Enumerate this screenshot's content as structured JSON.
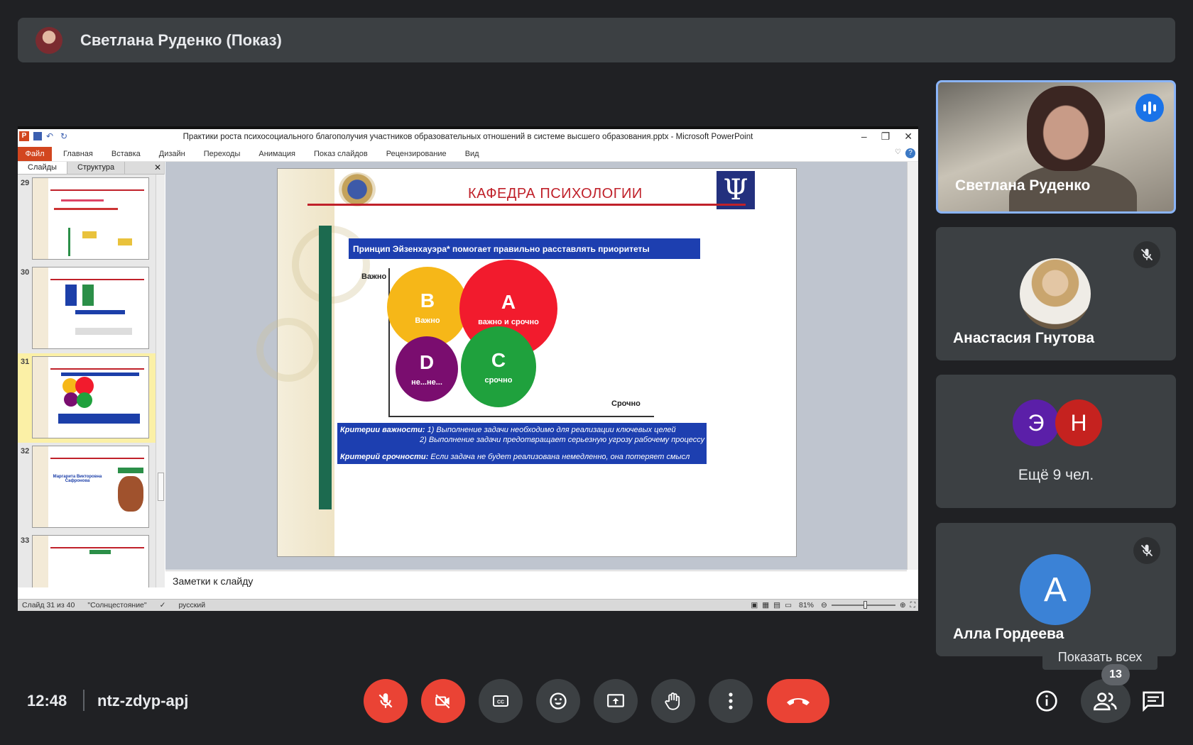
{
  "meet": {
    "presenter_title": "Светлана Руденко (Показ)",
    "clock": "12:48",
    "meeting_code": "ntz-zdyp-apj",
    "show_all_tooltip": "Показать всех",
    "participants_count": "13",
    "tiles": [
      {
        "name": "Светлана Руденко",
        "speaking": true
      },
      {
        "name": "Анастасия Гнутова",
        "muted": true
      },
      {
        "avatars": [
          {
            "letter": "Э",
            "color": "#5b1fa8"
          },
          {
            "letter": "Н",
            "color": "#c5221f"
          }
        ],
        "more": "Ещё 9 чел."
      },
      {
        "name": "Алла Гордеева",
        "letter": "А",
        "muted": true
      }
    ],
    "accent_red": "#ea4335",
    "accent_blue": "#1a73e8"
  },
  "ppt": {
    "window_title": "Практики роста психосоциального благополучия участников образовательных отношений в системе высшего образования.pptx  -  Microsoft PowerPoint",
    "ribbon_file": "Файл",
    "ribbon_tabs": [
      "Главная",
      "Вставка",
      "Дизайн",
      "Переходы",
      "Анимация",
      "Показ слайдов",
      "Рецензирование",
      "Вид"
    ],
    "panel_tabs": [
      "Слайды",
      "Структура"
    ],
    "thumb_numbers": [
      "29",
      "30",
      "31",
      "32",
      "33"
    ],
    "thumb32_name": "Маргарита Викторовна Сафронова",
    "notes_placeholder": "Заметки к слайду",
    "status": {
      "slide": "Слайд 31 из 40",
      "theme": "\"Солнцестояние\"",
      "lang": "русский",
      "zoom": "81%"
    },
    "slide": {
      "header": "КАФЕДРА ПСИХОЛОГИИ",
      "banner": "Принцип Эйзенхауэра* помогает правильно расставлять приоритеты",
      "axis_v": "Важно",
      "axis_h": "Срочно",
      "circles": [
        {
          "letter": "B",
          "label": "Важно",
          "color": "#f6b718"
        },
        {
          "letter": "A",
          "label": "важно и срочно",
          "color": "#f21b2d"
        },
        {
          "letter": "D",
          "label": "не...не...",
          "color": "#7a0d6f"
        },
        {
          "letter": "C",
          "label": "срочно",
          "color": "#1fa13d"
        }
      ],
      "crit1_head": "Критерии важности:",
      "crit1_a": "1) Выполнение задачи необходимо для реализации ключевых целей",
      "crit1_b": "2) Выполнение задачи предотвращает серьезную угрозу рабочему процессу",
      "crit2_head": "Критерий срочности:",
      "crit2_a": "Если задача не будет реализована немедленно, она потеряет смысл"
    }
  }
}
